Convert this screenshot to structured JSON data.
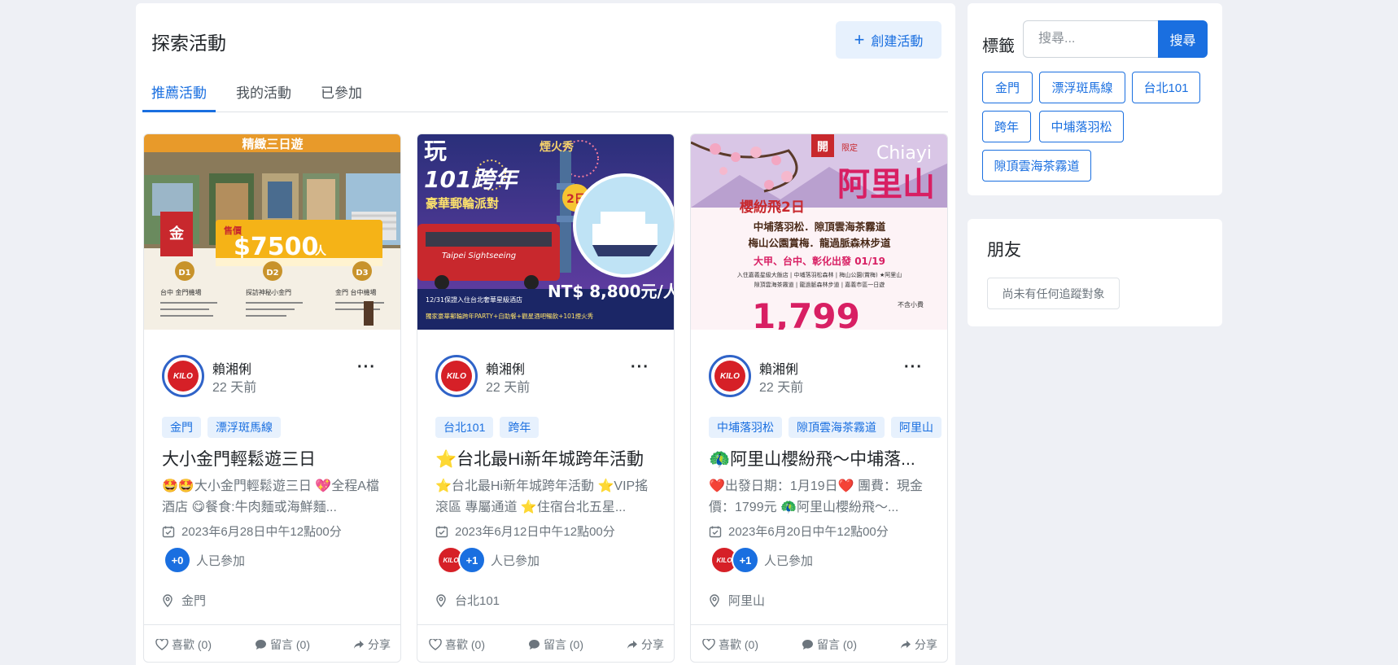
{
  "header": {
    "title": "探索活動",
    "create_label": "創建活動"
  },
  "tabs": [
    {
      "label": "推薦活動",
      "active": true
    },
    {
      "label": "我的活動",
      "active": false
    },
    {
      "label": "已參加",
      "active": false
    }
  ],
  "cards": [
    {
      "image": {
        "banner": "精緻三日遊",
        "price_label": "售價",
        "price": "$7500",
        "price_unit": "人",
        "days": [
          "D1",
          "D2",
          "D3"
        ],
        "day_titles": [
          "台中 金門機場",
          "探訪神秘小金門",
          "金門 台中機場"
        ]
      },
      "author": "賴湘俐",
      "time": "22 天前",
      "avatar_text": "KILO",
      "tags": [
        "金門",
        "漂浮斑馬線"
      ],
      "title": "大小金門輕鬆遊三日",
      "desc": "🤩🤩大小金門輕鬆遊三日 💖全程A檔酒店 😋餐食:牛肉麵或海鮮麵...",
      "date": "2023年6月28日中午12點00分",
      "participants_count": "+0",
      "participants_label": "人已參加",
      "show_participant_avatar": false,
      "location": "金門",
      "likes": "喜歡 (0)",
      "comments": "留言 (0)",
      "share": "分享"
    },
    {
      "image": {
        "line1": "101跨年",
        "line2": "煙火秀",
        "line3": "豪華郵輪派對",
        "days": "2日",
        "price": "NT$ 8,800元/人",
        "note": "12/31保證入住台北奢華星級酒店",
        "note2": "獨家豪華郵輪跨年PARTY+自助餐+觀星酒吧暢飲+101煙火秀",
        "bus": "Taipei Sightseeing"
      },
      "author": "賴湘俐",
      "time": "22 天前",
      "avatar_text": "KILO",
      "tags": [
        "台北101",
        "跨年"
      ],
      "title": "⭐台北最Hi新年城跨年活動",
      "desc": "⭐台北最Hi新年城跨年活動 ⭐VIP搖滾區 專屬通道 ⭐住宿台北五星...",
      "date": "2023年6月12日中午12點00分",
      "participants_count": "+1",
      "participants_label": "人已參加",
      "show_participant_avatar": true,
      "location": "台北101",
      "likes": "喜歡 (0)",
      "comments": "留言 (0)",
      "share": "分享"
    },
    {
      "image": {
        "badge1": "開",
        "badge2": "限定",
        "english": "Chiayi",
        "main": "阿里山",
        "subtitle": "櫻紛飛2日",
        "line1": "中埔落羽松．隙頂雲海茶霧道",
        "line2": "梅山公園賞梅．龍過脈森林步道",
        "depart": "大甲、台中、彰化出發 01/19",
        "small1": "入住嘉義星級大飯店 | 中埔落羽松森林 | 梅山公園(賞梅) ★阿里山",
        "small2": "隙頂雲海茶霧道 | 龍過脈森林步道 | 嘉義市區一日遊",
        "price": "1,799",
        "note": "不含小費"
      },
      "author": "賴湘俐",
      "time": "22 天前",
      "avatar_text": "KILO",
      "tags": [
        "中埔落羽松",
        "隙頂雲海茶霧道",
        "阿里山"
      ],
      "title": "🦚阿里山櫻紛飛～中埔落...",
      "desc": "❤️出發日期：1月19日❤️ 團費：現金價：1799元 🦚阿里山櫻紛飛～...",
      "date": "2023年6月20日中午12點00分",
      "participants_count": "+1",
      "participants_label": "人已參加",
      "show_participant_avatar": true,
      "location": "阿里山",
      "likes": "喜歡 (0)",
      "comments": "留言 (0)",
      "share": "分享"
    }
  ],
  "sidebar": {
    "tags_label": "標籤",
    "search_placeholder": "搜尋...",
    "search_button": "搜尋",
    "tag_chips": [
      "金門",
      "漂浮斑馬線",
      "台北101",
      "跨年",
      "中埔落羽松",
      "隙頂雲海茶霧道"
    ],
    "friends_title": "朋友",
    "friends_empty": "尚未有任何追蹤對象"
  },
  "colors": {
    "accent": "#1a6fe0",
    "background": "#eef0f5"
  }
}
